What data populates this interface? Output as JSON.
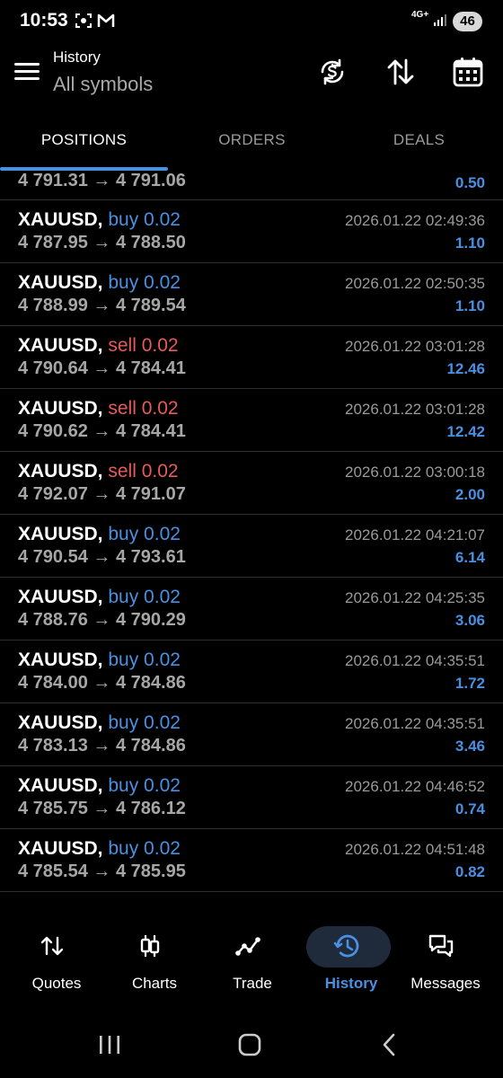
{
  "status_bar": {
    "time": "10:53",
    "network": "4G+",
    "battery": "46",
    "icons": [
      "screenshot-icon",
      "gmail-icon",
      "signal-icon"
    ]
  },
  "header": {
    "title": "History",
    "subtitle": "All symbols",
    "actions": [
      "currency-sync-icon",
      "sort-icon",
      "calendar-icon"
    ]
  },
  "tabs": [
    {
      "label": "POSITIONS",
      "active": true
    },
    {
      "label": "ORDERS",
      "active": false
    },
    {
      "label": "DEALS",
      "active": false
    }
  ],
  "partial_row": {
    "prices": "4 791.31 → 4 791.06",
    "profit": "0.50"
  },
  "positions": [
    {
      "symbol": "XAUUSD,",
      "side": "buy",
      "volume": "buy 0.02",
      "prices": "4 787.95 → 4 788.50",
      "time": "2026.01.22 02:49:36",
      "profit": "1.10"
    },
    {
      "symbol": "XAUUSD,",
      "side": "buy",
      "volume": "buy 0.02",
      "prices": "4 788.99 → 4 789.54",
      "time": "2026.01.22 02:50:35",
      "profit": "1.10"
    },
    {
      "symbol": "XAUUSD,",
      "side": "sell",
      "volume": "sell 0.02",
      "prices": "4 790.64 → 4 784.41",
      "time": "2026.01.22 03:01:28",
      "profit": "12.46"
    },
    {
      "symbol": "XAUUSD,",
      "side": "sell",
      "volume": "sell 0.02",
      "prices": "4 790.62 → 4 784.41",
      "time": "2026.01.22 03:01:28",
      "profit": "12.42"
    },
    {
      "symbol": "XAUUSD,",
      "side": "sell",
      "volume": "sell 0.02",
      "prices": "4 792.07 → 4 791.07",
      "time": "2026.01.22 03:00:18",
      "profit": "2.00"
    },
    {
      "symbol": "XAUUSD,",
      "side": "buy",
      "volume": "buy 0.02",
      "prices": "4 790.54 → 4 793.61",
      "time": "2026.01.22 04:21:07",
      "profit": "6.14"
    },
    {
      "symbol": "XAUUSD,",
      "side": "buy",
      "volume": "buy 0.02",
      "prices": "4 788.76 → 4 790.29",
      "time": "2026.01.22 04:25:35",
      "profit": "3.06"
    },
    {
      "symbol": "XAUUSD,",
      "side": "buy",
      "volume": "buy 0.02",
      "prices": "4 784.00 → 4 784.86",
      "time": "2026.01.22 04:35:51",
      "profit": "1.72"
    },
    {
      "symbol": "XAUUSD,",
      "side": "buy",
      "volume": "buy 0.02",
      "prices": "4 783.13 → 4 784.86",
      "time": "2026.01.22 04:35:51",
      "profit": "3.46"
    },
    {
      "symbol": "XAUUSD,",
      "side": "buy",
      "volume": "buy 0.02",
      "prices": "4 785.75 → 4 786.12",
      "time": "2026.01.22 04:46:52",
      "profit": "0.74"
    },
    {
      "symbol": "XAUUSD,",
      "side": "buy",
      "volume": "buy 0.02",
      "prices": "4 785.54 → 4 785.95",
      "time": "2026.01.22 04:51:48",
      "profit": "0.82"
    }
  ],
  "bottom_nav": [
    {
      "label": "Quotes",
      "icon": "quotes-arrows-icon",
      "active": false
    },
    {
      "label": "Charts",
      "icon": "candlestick-icon",
      "active": false
    },
    {
      "label": "Trade",
      "icon": "trend-line-icon",
      "active": false
    },
    {
      "label": "History",
      "icon": "history-clock-icon",
      "active": true
    },
    {
      "label": "Messages",
      "icon": "chat-bubbles-icon",
      "active": false
    }
  ],
  "colors": {
    "accent": "#4a90e2",
    "sell": "#e85a5a",
    "background": "#000000",
    "muted": "#9a9a9a"
  }
}
